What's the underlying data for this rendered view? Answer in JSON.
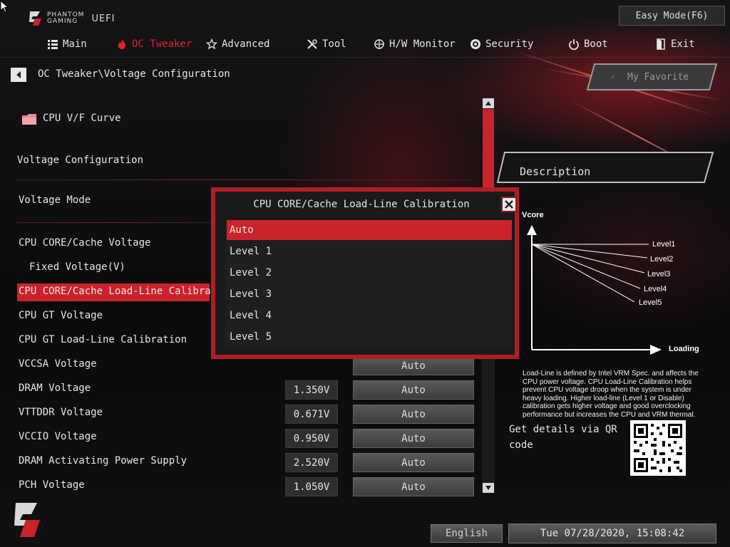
{
  "header": {
    "brand_line1": "PHANTOM",
    "brand_line2": "GAMING",
    "brand_suffix": "UEFI",
    "easy_mode_label": "Easy Mode(F6)"
  },
  "nav": {
    "items": [
      {
        "label": "Main",
        "icon": "list-icon"
      },
      {
        "label": "OC Tweaker",
        "icon": "flame-icon",
        "active": true
      },
      {
        "label": "Advanced",
        "icon": "star-icon"
      },
      {
        "label": "Tool",
        "icon": "tools-icon"
      },
      {
        "label": "H/W Monitor",
        "icon": "crosshair-icon"
      },
      {
        "label": "Security",
        "icon": "shield-icon"
      },
      {
        "label": "Boot",
        "icon": "power-icon"
      },
      {
        "label": "Exit",
        "icon": "exit-icon"
      }
    ]
  },
  "breadcrumb": "OC Tweaker\\Voltage Configuration",
  "favorite_label": "My Favorite",
  "settings": {
    "submenu": "CPU V/F Curve",
    "section_title": "Voltage Configuration",
    "voltage_mode": "Voltage Mode",
    "rows": [
      {
        "label": "CPU CORE/Cache Voltage"
      },
      {
        "label": "Fixed Voltage(V)"
      },
      {
        "label": "CPU CORE/Cache Load-Line Calibrat",
        "selected": true
      },
      {
        "label": "CPU GT Voltage"
      },
      {
        "label": "CPU GT Load-Line Calibration"
      },
      {
        "label": "VCCSA Voltage",
        "option": "Auto"
      },
      {
        "label": "DRAM Voltage",
        "value": "1.350V",
        "option": "Auto"
      },
      {
        "label": "VTTDDR Voltage",
        "value": "0.671V",
        "option": "Auto"
      },
      {
        "label": "VCCIO Voltage",
        "value": "0.950V",
        "option": "Auto"
      },
      {
        "label": "DRAM Activating Power Supply",
        "value": "2.520V",
        "option": "Auto"
      },
      {
        "label": "PCH Voltage",
        "value": "1.050V",
        "option": "Auto"
      }
    ]
  },
  "description": {
    "title": "Description",
    "diagram": {
      "y_label": "Vcore",
      "x_label": "Loading",
      "levels": [
        "Level1",
        "Level2",
        "Level3",
        "Level4",
        "Level5"
      ]
    },
    "text": "Load-Line is defined by Intel VRM Spec. and affects the CPU power voltage. CPU Load-Line Calibration helps prevent CPU voltage droop when the system is under heavy loading. Higher load-line (Level 1 or Disable) calibration gets higher voltage and good overclocking performance but increases the CPU and VRM thermal.",
    "qr_label": "Get details via QR code"
  },
  "modal": {
    "title": "CPU CORE/Cache Load-Line Calibration",
    "options": [
      "Auto",
      "Level 1",
      "Level 2",
      "Level 3",
      "Level 4",
      "Level 5"
    ],
    "selected": "Auto"
  },
  "footer": {
    "language": "English",
    "datetime": "Tue 07/28/2020, 15:08:42"
  },
  "colors": {
    "accent": "#c9232b",
    "accent_dark": "#8a1a1f",
    "background": "#0c0c0e"
  }
}
